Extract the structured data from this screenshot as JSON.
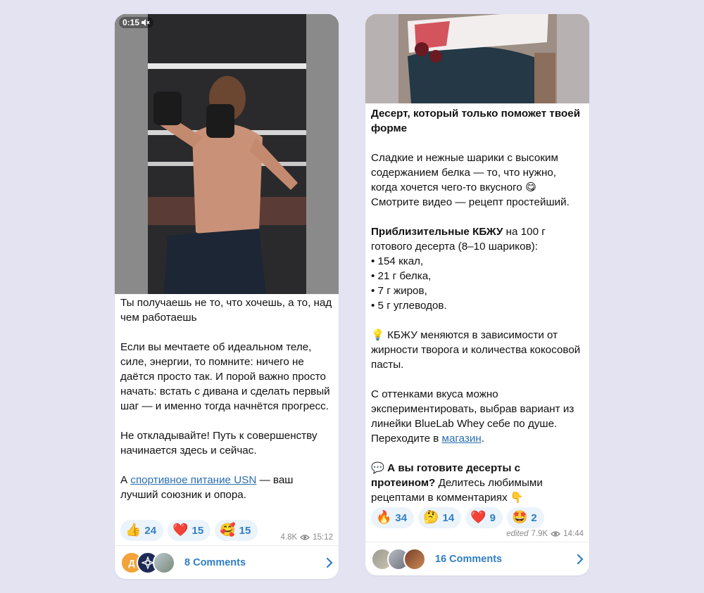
{
  "post1": {
    "video_time": "0:15",
    "caption_title": "Ты получаешь не то, что хочешь, а то, над чем работаешь",
    "paragraph1": "Если вы мечтаете об идеальном теле, силе, энергии, то помните: ничего не даётся просто так. И порой важно просто начать: встать с дивана и сделать первый шаг — и именно тогда начнётся прогресс.",
    "paragraph2": "Не откладывайте! Путь к совершенству начинается здесь и сейчас.",
    "p3_prefix": "А ",
    "p3_link": "спортивное питание USN",
    "p3_suffix": " — ваш лучший союзник и опора.",
    "reactions": [
      {
        "emoji": "👍",
        "count": "24"
      },
      {
        "emoji": "❤️",
        "count": "15"
      },
      {
        "emoji": "🥰",
        "count": "15"
      }
    ],
    "views": "4.8K",
    "time": "15:12",
    "avatar_letter": "Д",
    "comments_label": "8 Comments"
  },
  "post2": {
    "title": "Десерт, который только поможет твоей форме",
    "paragraph1": "Сладкие и нежные шарики с высоким содержанием белка — то, что нужно, когда хочется чего-то вкусного 😋 Смотрите видео — рецепт простейший.",
    "kbju_bold": "Приблизительные КБЖУ",
    "kbju_rest": " на 100 г готового десерта (8–10 шариков):",
    "list": [
      "• 154 ккал,",
      "• 21 г белка,",
      "• 7 г жиров,",
      "• 5 г углеводов."
    ],
    "tip_icon": "💡",
    "tip_text": " КБЖУ меняются в зависимости от жирности творога и количества кокосовой пасты.",
    "shades": "С оттенками вкуса можно экспериментировать, выбрав вариант из линейки BlueLab Whey себе по душе. Переходите в ",
    "shop_link": "магазин",
    "shop_end": ".",
    "q_icon": "💬",
    "q_bold": " А вы готовите десерты с протеином?",
    "q_rest": " Делитесь любимыми рецептами в комментариях 👇",
    "reactions": [
      {
        "emoji": "🔥",
        "count": "34"
      },
      {
        "emoji": "🤔",
        "count": "14"
      },
      {
        "emoji": "❤️",
        "count": "9"
      },
      {
        "emoji": "🤩",
        "count": "2"
      }
    ],
    "edited": "edited",
    "views": "7.9K",
    "time": "14:44",
    "comments_label": "16 Comments"
  },
  "colors": {
    "background": "#e3e3f2",
    "accent": "#2f7ec4",
    "link": "#2a6fb0"
  },
  "icons": [
    "muted-icon",
    "eye-icon",
    "chevron-right-icon"
  ]
}
